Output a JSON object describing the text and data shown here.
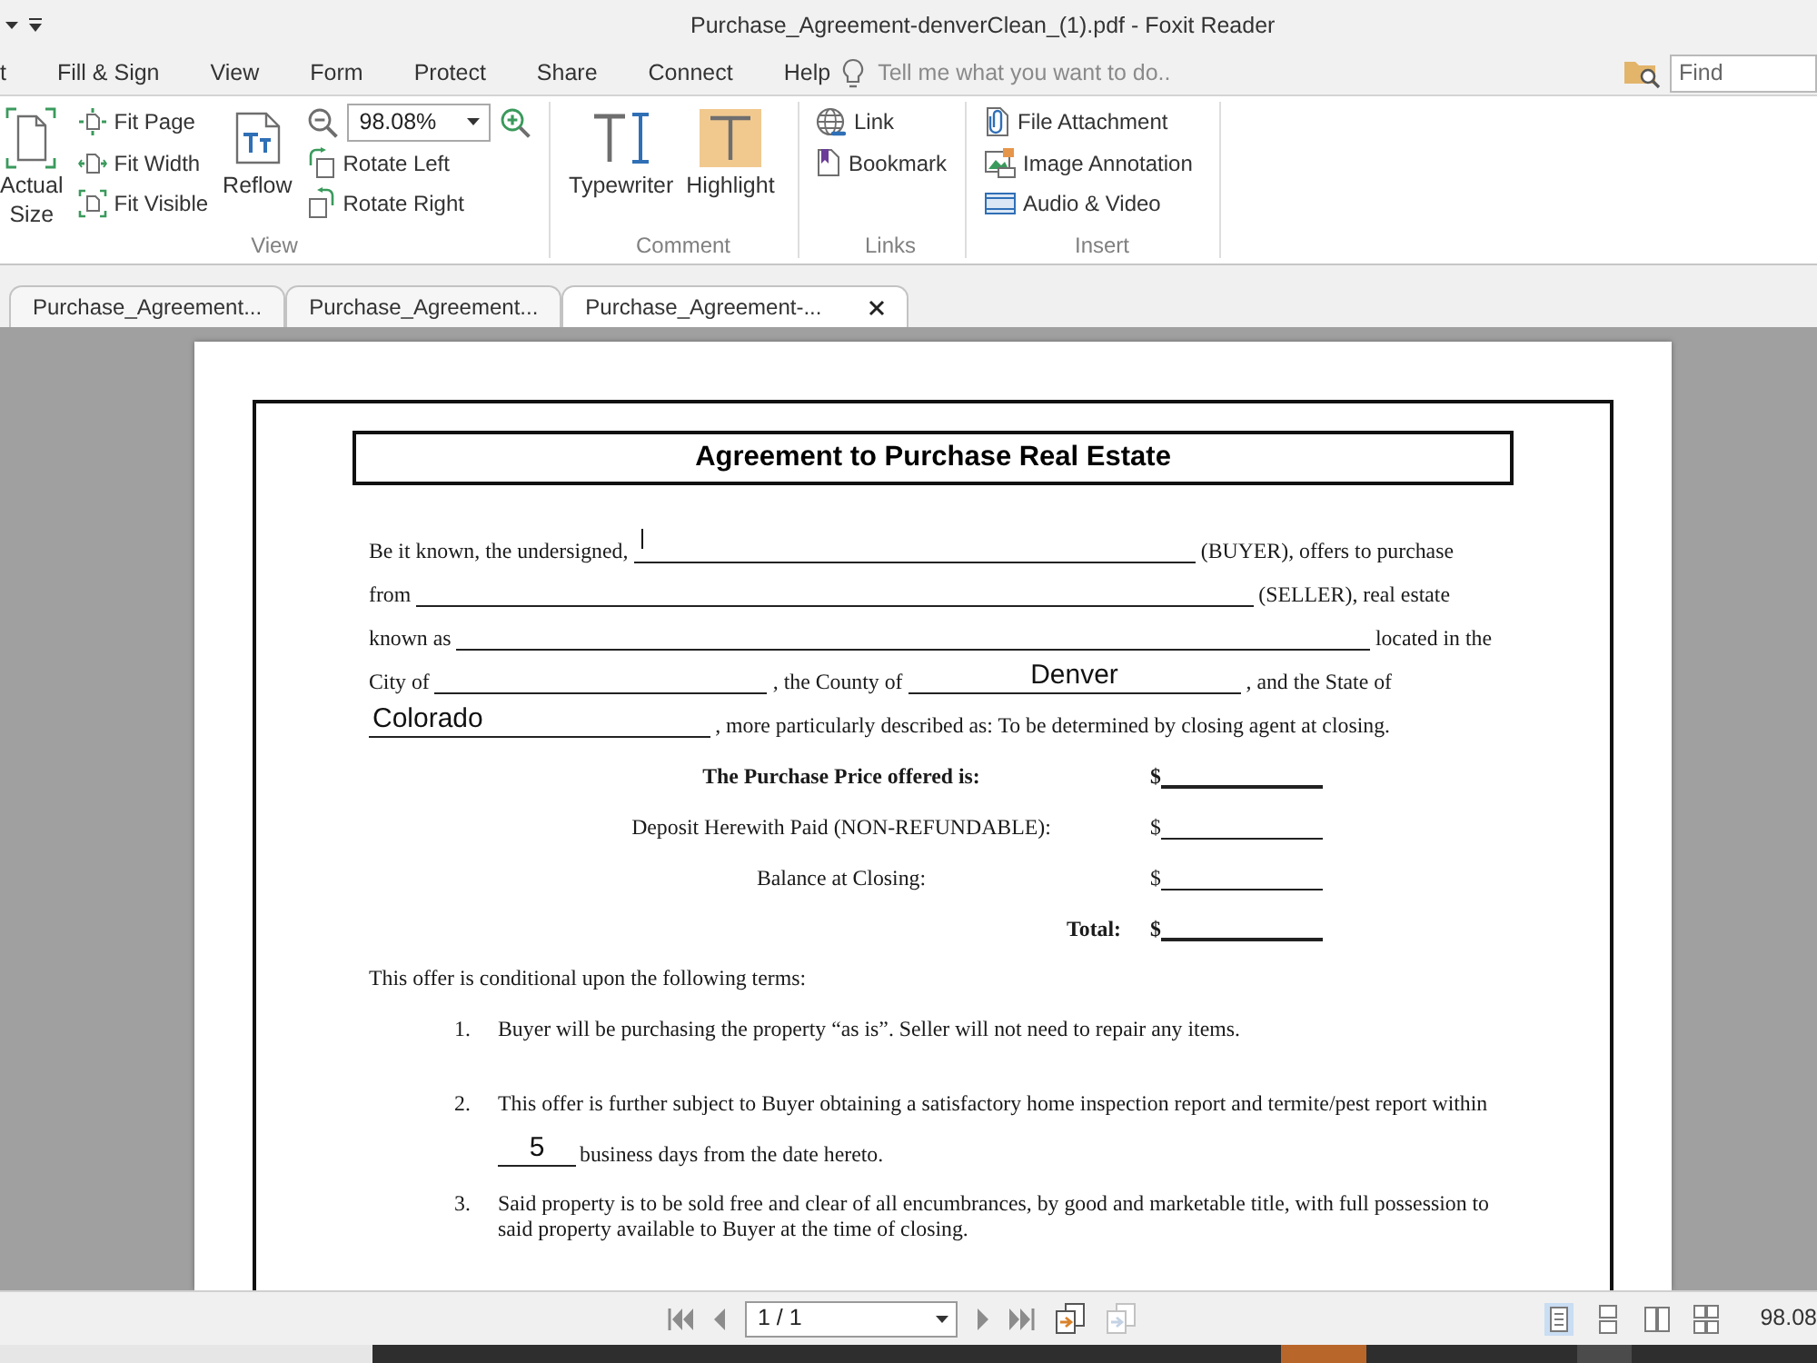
{
  "title_bar": {
    "title": "Purchase_Agreement-denverClean_(1).pdf - Foxit Reader"
  },
  "menu": {
    "items": [
      {
        "label": "t"
      },
      {
        "label": "Fill & Sign"
      },
      {
        "label": "View"
      },
      {
        "label": "Form"
      },
      {
        "label": "Protect"
      },
      {
        "label": "Share"
      },
      {
        "label": "Connect"
      },
      {
        "label": "Help"
      }
    ],
    "tell_me": {
      "placeholder": "Tell me what you want to do.."
    },
    "find": {
      "placeholder": "Find"
    }
  },
  "ribbon": {
    "groups": [
      {
        "label": "View",
        "columns": [
          {
            "kind": "large",
            "label": "Actual Size"
          },
          {
            "kind": "stack",
            "items": [
              {
                "kind": "button",
                "label": "Fit Page"
              },
              {
                "kind": "button",
                "label": "Fit Width"
              },
              {
                "kind": "button",
                "label": "Fit Visible"
              }
            ]
          },
          {
            "kind": "large",
            "label": "Reflow"
          },
          {
            "kind": "stack",
            "items": [
              {
                "kind": "zoom",
                "value": "98.08%"
              },
              {
                "kind": "button",
                "label": "Rotate Left"
              },
              {
                "kind": "button",
                "label": "Rotate Right"
              }
            ]
          }
        ]
      },
      {
        "label": "Comment",
        "columns": [
          {
            "kind": "large",
            "label": "Typewriter"
          },
          {
            "kind": "large",
            "label": "Highlight"
          }
        ]
      },
      {
        "label": "Links",
        "columns": [
          {
            "kind": "stack",
            "items": [
              {
                "kind": "button",
                "label": "Link"
              },
              {
                "kind": "button",
                "label": "Bookmark"
              }
            ]
          }
        ]
      },
      {
        "label": "Insert",
        "columns": [
          {
            "kind": "stack",
            "items": [
              {
                "kind": "button",
                "label": "File Attachment"
              },
              {
                "kind": "button",
                "label": "Image Annotation"
              },
              {
                "kind": "button",
                "label": "Audio & Video"
              }
            ]
          }
        ]
      }
    ]
  },
  "tabs": [
    {
      "label": "Purchase_Agreement...",
      "selected": false
    },
    {
      "label": "Purchase_Agreement...",
      "selected": false
    },
    {
      "label": "Purchase_Agreement-...",
      "selected": true
    }
  ],
  "document": {
    "title": "Agreement to Purchase Real Estate",
    "intro_lines": [
      [
        {
          "kind": "text",
          "text": "Be it known, the undersigned,"
        },
        {
          "kind": "blank",
          "focused": true
        },
        {
          "kind": "text",
          "text": "(BUYER), offers to purchase"
        }
      ],
      [
        {
          "kind": "text",
          "text": "from"
        },
        {
          "kind": "blank",
          "focused": false
        },
        {
          "kind": "text",
          "text": "(SELLER), real estate"
        }
      ],
      [
        {
          "kind": "text",
          "text": "known as"
        },
        {
          "kind": "blank",
          "focused": false
        },
        {
          "kind": "text",
          "text": "located in the"
        }
      ],
      [
        {
          "kind": "text",
          "text": "City of"
        },
        {
          "kind": "blank",
          "focused": false
        },
        {
          "kind": "text",
          "text": ", the County of"
        },
        {
          "kind": "blank",
          "focused": false,
          "value": "Denver"
        },
        {
          "kind": "text",
          "text": ", and the State of"
        }
      ],
      [
        {
          "kind": "blank",
          "focused": false,
          "value": "Colorado"
        },
        {
          "kind": "text",
          "text": ", more particularly described as:  To be determined by closing agent at closing."
        }
      ]
    ],
    "price_rows": [
      {
        "kind": "heading",
        "label": "The Purchase Price offered is:",
        "currency": "$"
      },
      {
        "kind": "item",
        "label": "Deposit Herewith Paid (NON-REFUNDABLE):",
        "currency": "$"
      },
      {
        "kind": "item",
        "label": "Balance at Closing:",
        "currency": "$"
      },
      {
        "kind": "total",
        "label": "Total:",
        "currency": "$"
      }
    ],
    "terms": {
      "intro": "This offer is conditional upon the following terms:",
      "items": [
        {
          "number": "1.",
          "lines": [
            [
              {
                "kind": "text",
                "text": "Buyer will be purchasing the property “as is”. Seller will not need to repair any items."
              }
            ]
          ]
        },
        {
          "number": "2.",
          "lines": [
            [
              {
                "kind": "text",
                "text": "This offer is further subject to Buyer obtaining a satisfactory home inspection report and termite/pest report within"
              }
            ],
            [
              {
                "kind": "blank",
                "focused": false,
                "value": "5"
              },
              {
                "kind": "text",
                "text": "business days from the date hereto."
              }
            ]
          ]
        },
        {
          "number": "3.",
          "lines": [
            [
              {
                "kind": "text",
                "text": "Said property is to be sold free and clear of all encumbrances, by good and marketable title, with full possession to said property available to Buyer at the time of closing."
              }
            ]
          ]
        }
      ]
    }
  },
  "status_bar": {
    "page_field": {
      "value": "1 / 1"
    },
    "page_tools": [
      {
        "disabled": false
      },
      {
        "disabled": true
      }
    ],
    "view_modes": [
      {
        "selected": true
      },
      {
        "selected": false
      },
      {
        "selected": false
      },
      {
        "selected": false
      }
    ],
    "zoom": "98.08"
  }
}
